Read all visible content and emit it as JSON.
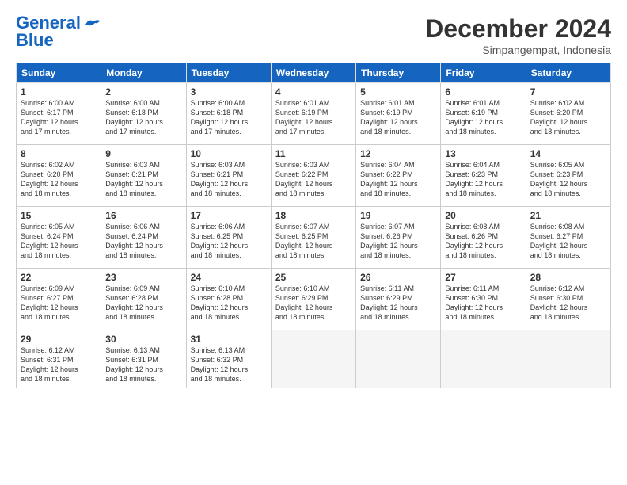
{
  "logo": {
    "part1": "General",
    "part2": "Blue"
  },
  "header": {
    "month": "December 2024",
    "location": "Simpangempat, Indonesia"
  },
  "weekdays": [
    "Sunday",
    "Monday",
    "Tuesday",
    "Wednesday",
    "Thursday",
    "Friday",
    "Saturday"
  ],
  "weeks": [
    [
      {
        "day": "1",
        "info": "Sunrise: 6:00 AM\nSunset: 6:17 PM\nDaylight: 12 hours\nand 17 minutes."
      },
      {
        "day": "2",
        "info": "Sunrise: 6:00 AM\nSunset: 6:18 PM\nDaylight: 12 hours\nand 17 minutes."
      },
      {
        "day": "3",
        "info": "Sunrise: 6:00 AM\nSunset: 6:18 PM\nDaylight: 12 hours\nand 17 minutes."
      },
      {
        "day": "4",
        "info": "Sunrise: 6:01 AM\nSunset: 6:19 PM\nDaylight: 12 hours\nand 17 minutes."
      },
      {
        "day": "5",
        "info": "Sunrise: 6:01 AM\nSunset: 6:19 PM\nDaylight: 12 hours\nand 18 minutes."
      },
      {
        "day": "6",
        "info": "Sunrise: 6:01 AM\nSunset: 6:19 PM\nDaylight: 12 hours\nand 18 minutes."
      },
      {
        "day": "7",
        "info": "Sunrise: 6:02 AM\nSunset: 6:20 PM\nDaylight: 12 hours\nand 18 minutes."
      }
    ],
    [
      {
        "day": "8",
        "info": "Sunrise: 6:02 AM\nSunset: 6:20 PM\nDaylight: 12 hours\nand 18 minutes."
      },
      {
        "day": "9",
        "info": "Sunrise: 6:03 AM\nSunset: 6:21 PM\nDaylight: 12 hours\nand 18 minutes."
      },
      {
        "day": "10",
        "info": "Sunrise: 6:03 AM\nSunset: 6:21 PM\nDaylight: 12 hours\nand 18 minutes."
      },
      {
        "day": "11",
        "info": "Sunrise: 6:03 AM\nSunset: 6:22 PM\nDaylight: 12 hours\nand 18 minutes."
      },
      {
        "day": "12",
        "info": "Sunrise: 6:04 AM\nSunset: 6:22 PM\nDaylight: 12 hours\nand 18 minutes."
      },
      {
        "day": "13",
        "info": "Sunrise: 6:04 AM\nSunset: 6:23 PM\nDaylight: 12 hours\nand 18 minutes."
      },
      {
        "day": "14",
        "info": "Sunrise: 6:05 AM\nSunset: 6:23 PM\nDaylight: 12 hours\nand 18 minutes."
      }
    ],
    [
      {
        "day": "15",
        "info": "Sunrise: 6:05 AM\nSunset: 6:24 PM\nDaylight: 12 hours\nand 18 minutes."
      },
      {
        "day": "16",
        "info": "Sunrise: 6:06 AM\nSunset: 6:24 PM\nDaylight: 12 hours\nand 18 minutes."
      },
      {
        "day": "17",
        "info": "Sunrise: 6:06 AM\nSunset: 6:25 PM\nDaylight: 12 hours\nand 18 minutes."
      },
      {
        "day": "18",
        "info": "Sunrise: 6:07 AM\nSunset: 6:25 PM\nDaylight: 12 hours\nand 18 minutes."
      },
      {
        "day": "19",
        "info": "Sunrise: 6:07 AM\nSunset: 6:26 PM\nDaylight: 12 hours\nand 18 minutes."
      },
      {
        "day": "20",
        "info": "Sunrise: 6:08 AM\nSunset: 6:26 PM\nDaylight: 12 hours\nand 18 minutes."
      },
      {
        "day": "21",
        "info": "Sunrise: 6:08 AM\nSunset: 6:27 PM\nDaylight: 12 hours\nand 18 minutes."
      }
    ],
    [
      {
        "day": "22",
        "info": "Sunrise: 6:09 AM\nSunset: 6:27 PM\nDaylight: 12 hours\nand 18 minutes."
      },
      {
        "day": "23",
        "info": "Sunrise: 6:09 AM\nSunset: 6:28 PM\nDaylight: 12 hours\nand 18 minutes."
      },
      {
        "day": "24",
        "info": "Sunrise: 6:10 AM\nSunset: 6:28 PM\nDaylight: 12 hours\nand 18 minutes."
      },
      {
        "day": "25",
        "info": "Sunrise: 6:10 AM\nSunset: 6:29 PM\nDaylight: 12 hours\nand 18 minutes."
      },
      {
        "day": "26",
        "info": "Sunrise: 6:11 AM\nSunset: 6:29 PM\nDaylight: 12 hours\nand 18 minutes."
      },
      {
        "day": "27",
        "info": "Sunrise: 6:11 AM\nSunset: 6:30 PM\nDaylight: 12 hours\nand 18 minutes."
      },
      {
        "day": "28",
        "info": "Sunrise: 6:12 AM\nSunset: 6:30 PM\nDaylight: 12 hours\nand 18 minutes."
      }
    ],
    [
      {
        "day": "29",
        "info": "Sunrise: 6:12 AM\nSunset: 6:31 PM\nDaylight: 12 hours\nand 18 minutes."
      },
      {
        "day": "30",
        "info": "Sunrise: 6:13 AM\nSunset: 6:31 PM\nDaylight: 12 hours\nand 18 minutes."
      },
      {
        "day": "31",
        "info": "Sunrise: 6:13 AM\nSunset: 6:32 PM\nDaylight: 12 hours\nand 18 minutes."
      },
      null,
      null,
      null,
      null
    ]
  ]
}
